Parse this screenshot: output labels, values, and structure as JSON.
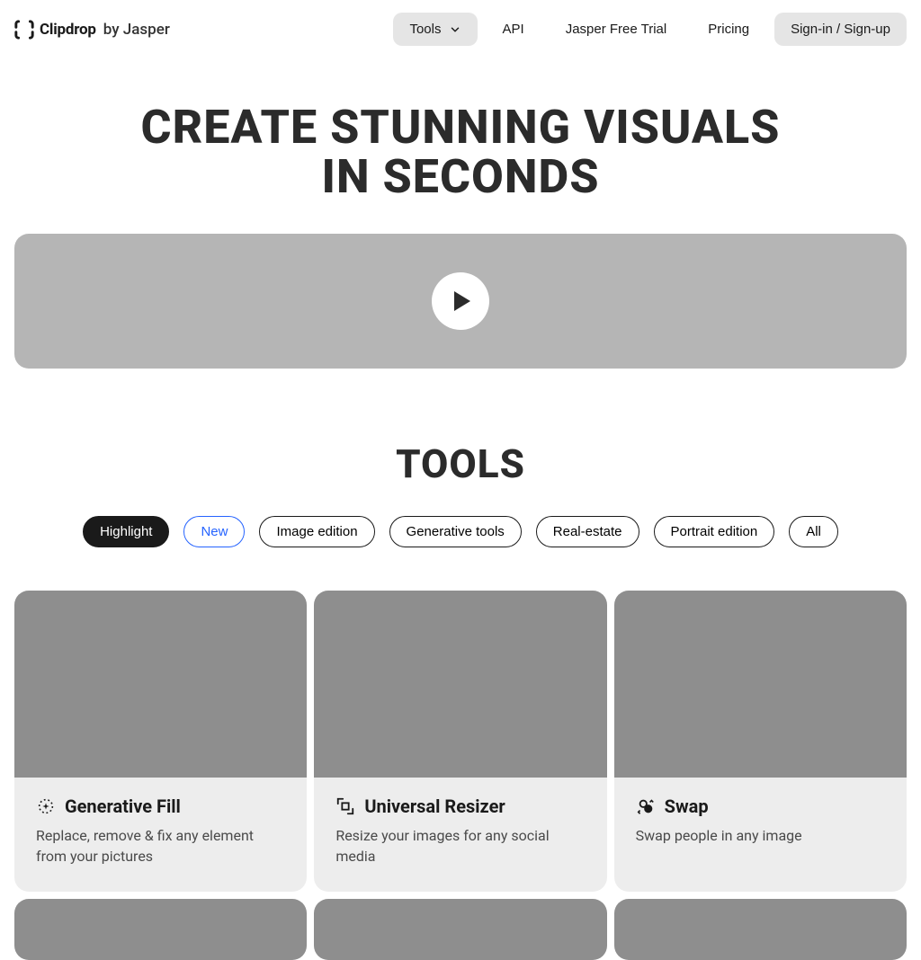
{
  "brand": {
    "name": "Clipdrop",
    "by": "by Jasper"
  },
  "nav": {
    "tools": "Tools",
    "api": "API",
    "trial": "Jasper Free Trial",
    "pricing": "Pricing",
    "signin": "Sign-in / Sign-up"
  },
  "hero": {
    "title_line1": "CREATE STUNNING VISUALS",
    "title_line2": "IN SECONDS"
  },
  "tools": {
    "heading": "TOOLS",
    "filters": [
      {
        "label": "Highlight",
        "state": "selected"
      },
      {
        "label": "New",
        "state": "new"
      },
      {
        "label": "Image edition",
        "state": "default"
      },
      {
        "label": "Generative tools",
        "state": "default"
      },
      {
        "label": "Real-estate",
        "state": "default"
      },
      {
        "label": "Portrait edition",
        "state": "default"
      },
      {
        "label": "All",
        "state": "default"
      }
    ],
    "cards": [
      {
        "title": "Generative Fill",
        "desc": "Replace, remove & fix any element from your pictures",
        "icon": "sparkle-circle-icon"
      },
      {
        "title": "Universal Resizer",
        "desc": "Resize your images for any social media",
        "icon": "resize-icon"
      },
      {
        "title": "Swap",
        "desc": "Swap people in any image",
        "icon": "swap-icon"
      }
    ]
  }
}
